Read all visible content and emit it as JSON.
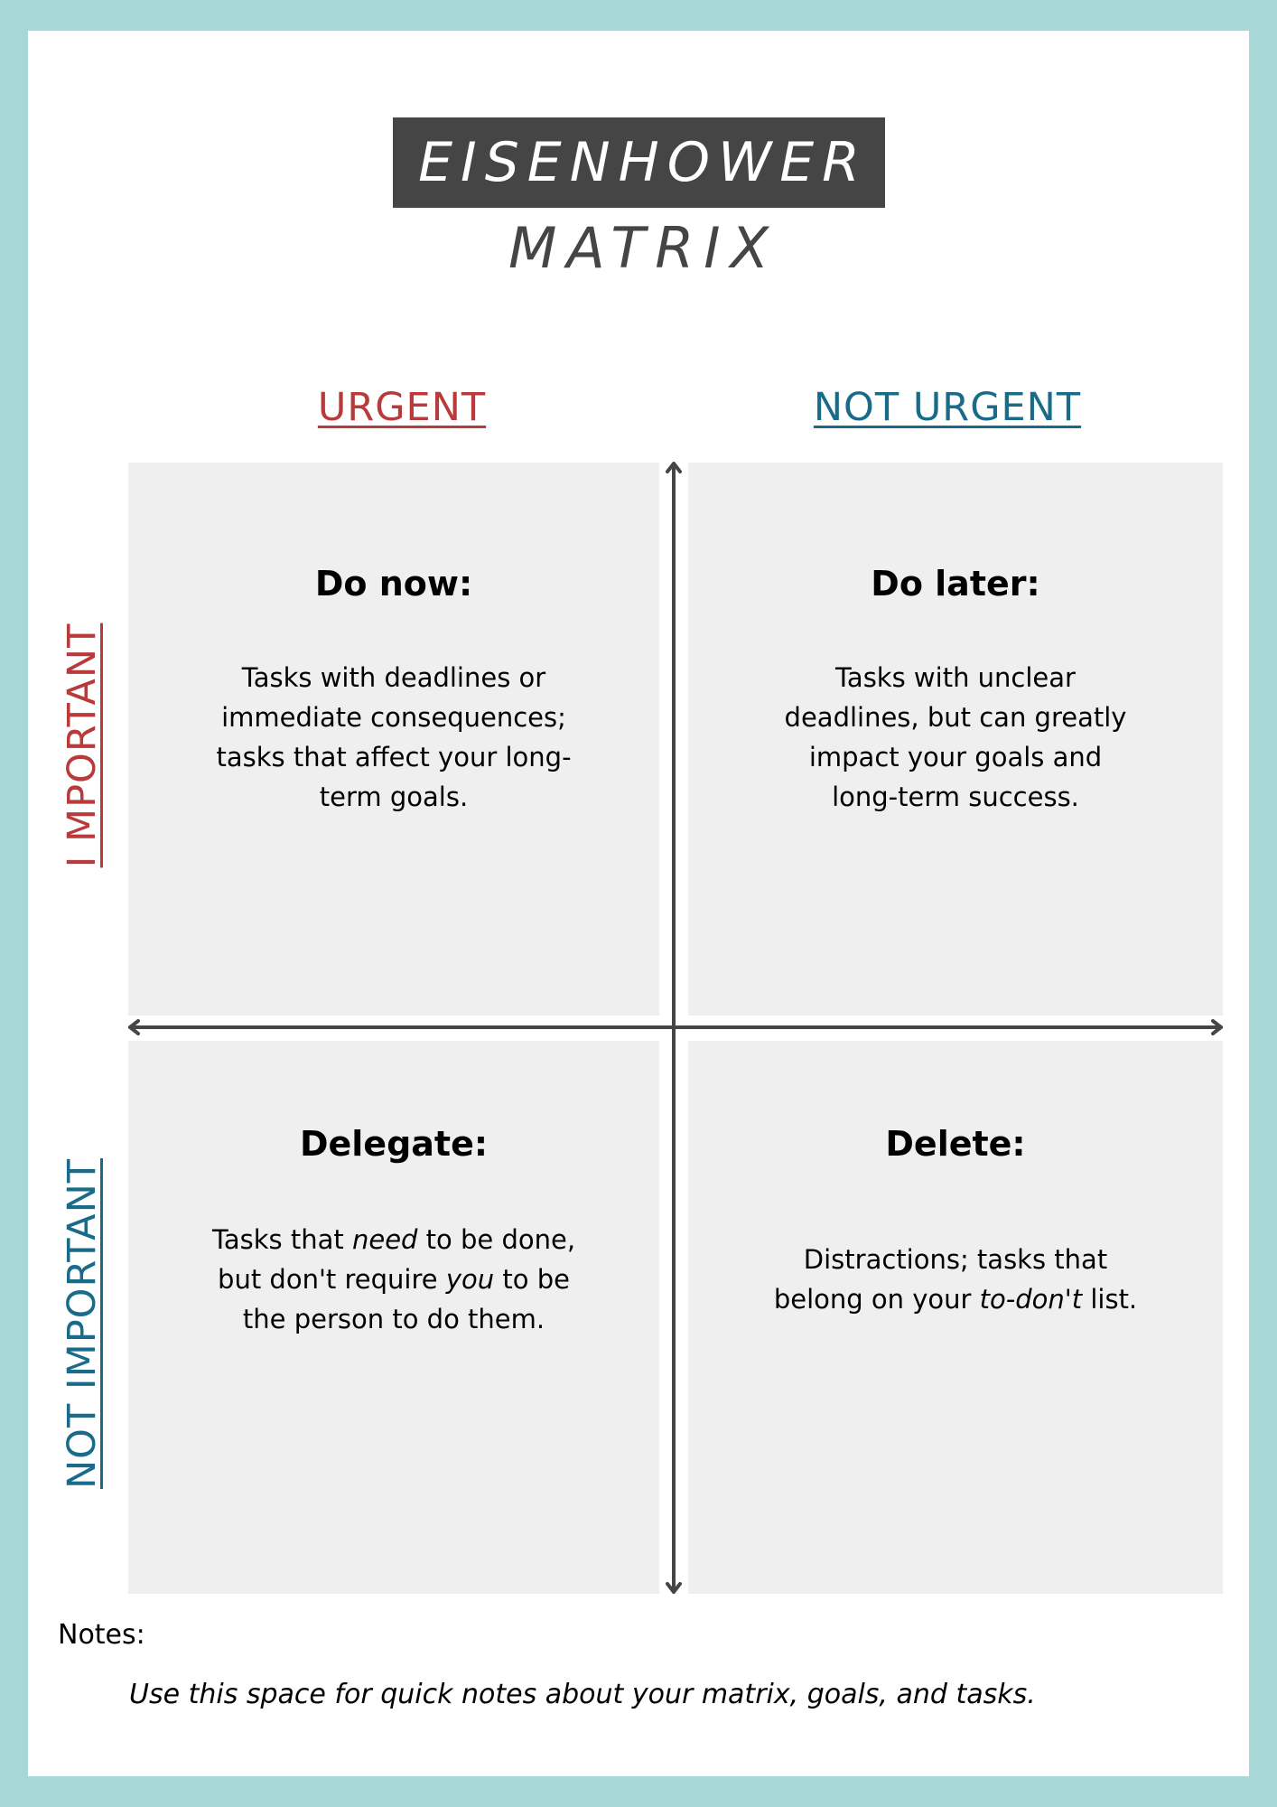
{
  "title": {
    "line1": "EISENHOWER",
    "line2": "MATRIX"
  },
  "columns": {
    "urgent": "URGENT",
    "not_urgent": "NOT URGENT"
  },
  "rows": {
    "important": "I MPORTANT",
    "not_important": "NOT IMPORTANT"
  },
  "colors": {
    "border": "#a7d7d7",
    "title_box": "#454545",
    "urgent_red": "#b83a3a",
    "not_urgent_teal": "#1a6b8a",
    "quadrant_bg": "#efefef",
    "axis": "#454545"
  },
  "quadrants": {
    "do_now": {
      "title": "Do now:",
      "lines": [
        "Tasks with deadlines or",
        "immediate consequences;",
        "tasks that affect your long-",
        "term goals."
      ]
    },
    "do_later": {
      "title": "Do later:",
      "lines": [
        "Tasks with unclear",
        "deadlines, but can greatly",
        "impact your goals and",
        "long-term success."
      ]
    },
    "delegate": {
      "title": "Delegate:",
      "line1": {
        "pre": "Tasks that ",
        "em": "need",
        "post": " to be done,"
      },
      "line2": {
        "pre": "but don't require ",
        "em": "you",
        "post": " to be"
      },
      "line3": "the person to do them."
    },
    "delete": {
      "title": "Delete:",
      "line1": "Distractions; tasks that",
      "line2": {
        "pre": "belong on your ",
        "em": "to-don't",
        "post": " list."
      }
    }
  },
  "notes": {
    "label": "Notes:",
    "text": "Use this space for quick notes about your matrix, goals, and tasks."
  }
}
